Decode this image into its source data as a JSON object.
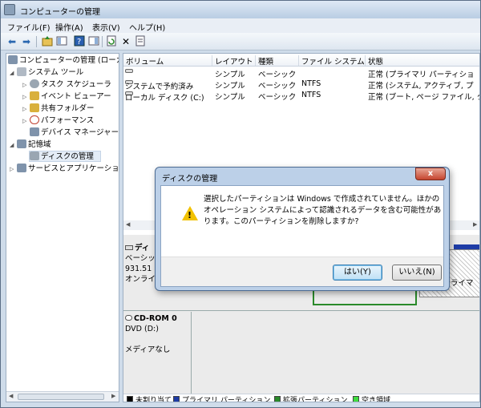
{
  "window": {
    "title": "コンピューターの管理"
  },
  "menu": [
    "ファイル(F)",
    "操作(A)",
    "表示(V)",
    "ヘルプ(H)"
  ],
  "toolbar": {
    "buttons": [
      "back-icon",
      "forward-icon",
      "up-icon",
      "view-icon",
      "help-icon",
      "pane-icon",
      "refresh-icon",
      "delete-icon",
      "properties-icon"
    ],
    "back": "⬅",
    "forward": "➡",
    "delete": "✕"
  },
  "tree": [
    {
      "label": "コンピューターの管理 (ローカ",
      "icon": "computer-icon",
      "color": "#7f93ab"
    },
    {
      "label": "システム ツール",
      "icon": "tools-icon",
      "color": "#b0b9c4"
    },
    {
      "label": "タスク スケジューラ",
      "icon": "clock-icon",
      "color": "#9aa6b2"
    },
    {
      "label": "イベント ビューアー",
      "icon": "event-icon",
      "color": "#d9b03c"
    },
    {
      "label": "共有フォルダー",
      "icon": "folder-icon",
      "color": "#d9b03c"
    },
    {
      "label": "パフォーマンス",
      "icon": "performance-icon",
      "color": "#c04030"
    },
    {
      "label": "デバイス マネージャー",
      "icon": "device-icon",
      "color": "#7f93ab"
    },
    {
      "label": "記憶域",
      "icon": "storage-icon",
      "color": "#7f93ab"
    },
    {
      "label": "ディスクの管理",
      "icon": "disk-icon",
      "color": "#9aa6b2"
    },
    {
      "label": "サービスとアプリケーショ",
      "icon": "services-icon",
      "color": "#7f93ab"
    }
  ],
  "volume_table": {
    "headers": [
      "ボリューム",
      "レイアウト",
      "種類",
      "ファイル システム",
      "状態"
    ],
    "rows": [
      {
        "vol": "",
        "layout": "シンプル",
        "type": "ベーシック",
        "fs": "",
        "status": "正常 (プライマリ パーティショ"
      },
      {
        "vol": "システムで予約済み",
        "layout": "シンプル",
        "type": "ベーシック",
        "fs": "NTFS",
        "status": "正常 (システム, アクティブ, プ"
      },
      {
        "vol": "ローカル ディスク (C:)",
        "layout": "シンプル",
        "type": "ベーシック",
        "fs": "NTFS",
        "status": "正常 (ブート, ページ ファイル, ク"
      }
    ]
  },
  "disk0": {
    "name": "ディ",
    "line1": "ベーシッ",
    "line2": "931.51",
    "line3": "オンライ",
    "right_label": "ライマ"
  },
  "cdrom": {
    "name": "CD-ROM 0",
    "line1": "DVD (D:)",
    "line2": "メディアなし"
  },
  "legend": [
    {
      "label": "未割り当て",
      "color": "#000000"
    },
    {
      "label": "プライマリ パーティション",
      "color": "#1e3ca6"
    },
    {
      "label": "拡張パーティション",
      "color": "#2a8a2a"
    },
    {
      "label": "空き領域",
      "color": "#3fdc3f"
    }
  ],
  "dialog": {
    "title": "ディスクの管理",
    "close": "x",
    "message_lines": [
      "選択したパーティションは Windows で作成されていません。ほかの",
      "オペレーション システムによって認識されるデータを含む可能性があ",
      "ります。このパーティションを削除しますか?"
    ],
    "yes": "はい(Y)",
    "no": "いいえ(N)"
  }
}
